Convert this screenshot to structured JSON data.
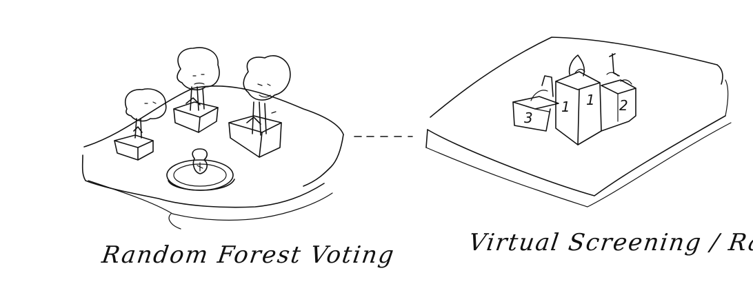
{
  "captions": {
    "left": "Random Forest Voting",
    "right": "Virtual Screening / Ranking"
  },
  "podium": {
    "rank_left": "3",
    "rank_center_a": "1",
    "rank_center_b": "1",
    "rank_right": "2"
  },
  "colors": {
    "ink": "#111111",
    "background": "#ffffff"
  }
}
